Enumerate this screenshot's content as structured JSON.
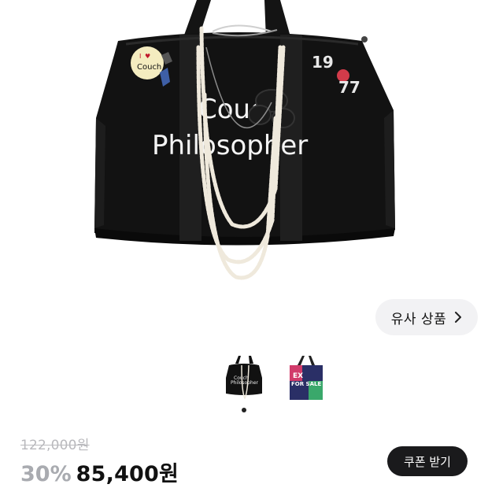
{
  "product": {
    "image_text": {
      "line1": "Couch",
      "line2": "Philosopher"
    },
    "badge_text": {
      "top": "I",
      "heart": "♥",
      "bottom": "Couch"
    },
    "patch_text": {
      "a": "19",
      "b": "77"
    }
  },
  "similar": {
    "label": "유사 상품"
  },
  "thumbnails": [
    {
      "alt": "Couch Philosopher black tote"
    },
    {
      "text_line1": "EX",
      "text_line2": "FOR SALE"
    }
  ],
  "carousel": {
    "total": 2,
    "active": 1
  },
  "price": {
    "original": "122,000원",
    "discount": "30%",
    "sale": "85,400원"
  },
  "coupon": {
    "label": "쿠폰 받기"
  },
  "colors": {
    "bag": "#111111",
    "pearl": "#efe9dc",
    "coupon_bg": "#1a1a1c",
    "pill_bg": "#f2f2f4"
  }
}
